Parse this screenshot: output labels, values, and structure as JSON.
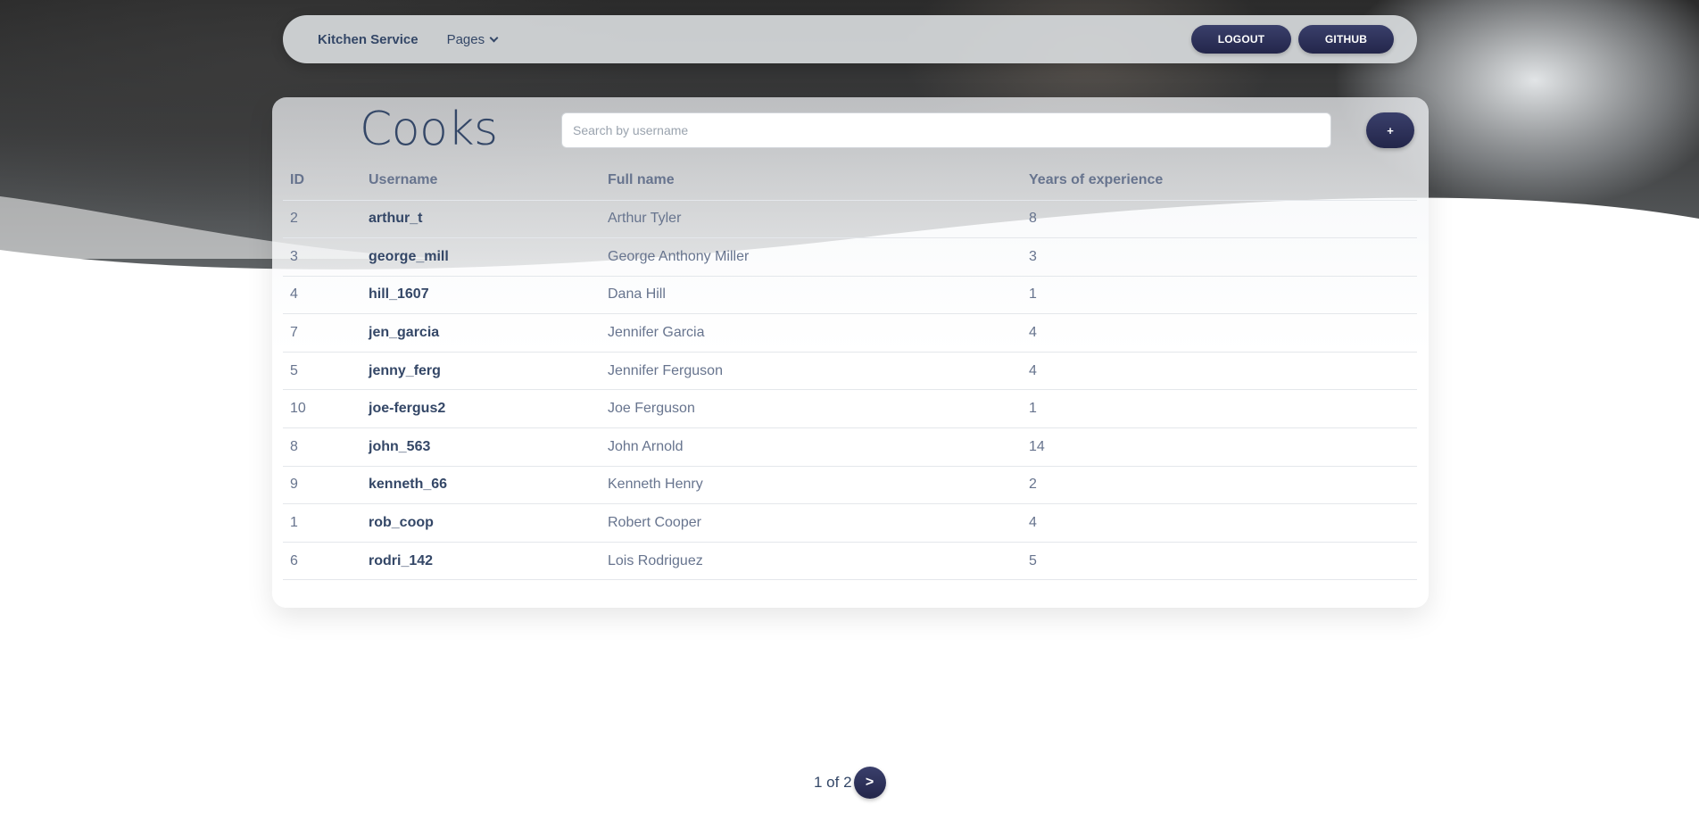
{
  "navbar": {
    "brand": "Kitchen Service",
    "pages_label": "Pages",
    "logout_label": "LOGOUT",
    "github_label": "GITHUB"
  },
  "main": {
    "title": "Cooks",
    "search_placeholder": "Search by username",
    "add_label": "+",
    "table": {
      "headers": {
        "id": "ID",
        "username": "Username",
        "full_name": "Full name",
        "experience": "Years of experience"
      },
      "rows": [
        {
          "id": "2",
          "username": "arthur_t",
          "full_name": "Arthur Tyler",
          "experience": "8"
        },
        {
          "id": "3",
          "username": "george_mill",
          "full_name": "George Anthony Miller",
          "experience": "3"
        },
        {
          "id": "4",
          "username": "hill_1607",
          "full_name": "Dana Hill",
          "experience": "1"
        },
        {
          "id": "7",
          "username": "jen_garcia",
          "full_name": "Jennifer Garcia",
          "experience": "4"
        },
        {
          "id": "5",
          "username": "jenny_ferg",
          "full_name": "Jennifer Ferguson",
          "experience": "4"
        },
        {
          "id": "10",
          "username": "joe-fergus2",
          "full_name": "Joe Ferguson",
          "experience": "1"
        },
        {
          "id": "8",
          "username": "john_563",
          "full_name": "John Arnold",
          "experience": "14"
        },
        {
          "id": "9",
          "username": "kenneth_66",
          "full_name": "Kenneth Henry",
          "experience": "2"
        },
        {
          "id": "1",
          "username": "rob_coop",
          "full_name": "Robert Cooper",
          "experience": "4"
        },
        {
          "id": "6",
          "username": "rodri_142",
          "full_name": "Lois Rodriguez",
          "experience": "5"
        }
      ]
    }
  },
  "pagination": {
    "status": "1 of 2",
    "next_label": ">"
  },
  "colors": {
    "accent": "#2b2f5a",
    "text_dark": "#344767",
    "text_muted": "#67748e"
  }
}
